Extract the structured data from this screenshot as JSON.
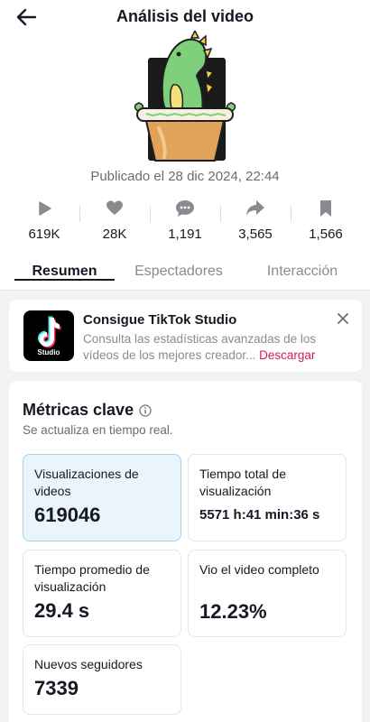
{
  "header": {
    "title": "Análisis del video"
  },
  "video": {
    "published": "Publicado el 28 dic 2024, 22:44"
  },
  "stats": [
    {
      "icon": "play-icon",
      "value": "619K"
    },
    {
      "icon": "heart-icon",
      "value": "28K"
    },
    {
      "icon": "comment-icon",
      "value": "1,191"
    },
    {
      "icon": "share-icon",
      "value": "3,565"
    },
    {
      "icon": "bookmark-icon",
      "value": "1,566"
    }
  ],
  "tabs": [
    {
      "label": "Resumen",
      "active": true
    },
    {
      "label": "Espectadores",
      "active": false
    },
    {
      "label": "Interacción",
      "active": false
    }
  ],
  "promo": {
    "logo_label": "Studio",
    "title": "Consigue TikTok Studio",
    "description": "Consulta las estadísticas avanzadas de los vídeos de los mejores creador...",
    "link": "Descargar"
  },
  "metrics": {
    "title": "Métricas clave",
    "subtitle": "Se actualiza en tiempo real.",
    "cards": [
      {
        "label": "Visualizaciones de videos",
        "value": "619046"
      },
      {
        "label": "Tiempo total de visualización",
        "value": "5571 h:41 min:36 s"
      },
      {
        "label": "Tiempo promedio de visualización",
        "value": "29.4 s"
      },
      {
        "label": "Vio el video completo",
        "value": "12.23%"
      },
      {
        "label": "Nuevos seguidores",
        "value": "7339"
      }
    ]
  },
  "colors": {
    "accent_link": "#d3195f",
    "highlight_card": "#eaf4fb",
    "text": "#161823",
    "muted": "#8a8b91"
  }
}
